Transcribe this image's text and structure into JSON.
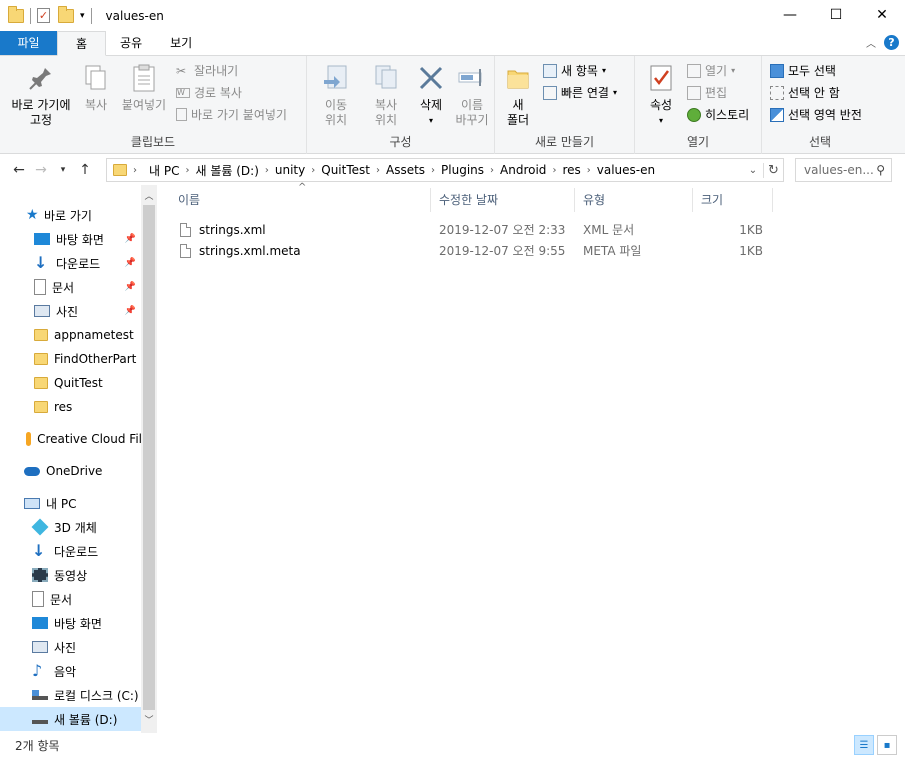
{
  "window": {
    "title": "values-en"
  },
  "ribbon_tabs": [
    {
      "label": "파일"
    },
    {
      "label": "홈"
    },
    {
      "label": "공유"
    },
    {
      "label": "보기"
    }
  ],
  "ribbon": {
    "clipboard": {
      "label": "클립보드",
      "pin": "바로 가기에\n고정",
      "copy": "복사",
      "paste": "붙여넣기",
      "cut": "잘라내기",
      "copy_path": "경로 복사",
      "paste_shortcut": "바로 가기 붙여넣기"
    },
    "organize": {
      "label": "구성",
      "move": "이동\n위치",
      "copyto": "복사\n위치",
      "delete": "삭제",
      "rename": "이름\n바꾸기"
    },
    "new": {
      "label": "새로 만들기",
      "new_folder": "새\n폴더",
      "new_item": "새 항목",
      "easy_access": "빠른 연결"
    },
    "open": {
      "label": "열기",
      "properties": "속성",
      "open": "열기",
      "edit": "편집",
      "history": "히스토리"
    },
    "select": {
      "label": "선택",
      "select_all": "모두 선택",
      "select_none": "선택 안 함",
      "invert": "선택 영역 반전"
    }
  },
  "address": {
    "crumbs": [
      "내 PC",
      "새 볼륨 (D:)",
      "unity",
      "QuitTest",
      "Assets",
      "Plugins",
      "Android",
      "res",
      "values-en"
    ],
    "search_placeholder": "values-en..."
  },
  "nav": [
    {
      "label": "바로 가기",
      "icon": "star-icon",
      "indent": 0,
      "pinned": false
    },
    {
      "label": "바탕 화면",
      "icon": "desktop-icon",
      "indent": 1,
      "pinned": true
    },
    {
      "label": "다운로드",
      "icon": "download-icon",
      "indent": 1,
      "pinned": true
    },
    {
      "label": "문서",
      "icon": "document-icon",
      "indent": 1,
      "pinned": true
    },
    {
      "label": "사진",
      "icon": "pictures-icon",
      "indent": 1,
      "pinned": true
    },
    {
      "label": "appnametest",
      "icon": "folder-icon",
      "indent": 1,
      "pinned": false
    },
    {
      "label": "FindOtherPart",
      "icon": "folder-icon",
      "indent": 1,
      "pinned": false
    },
    {
      "label": "QuitTest",
      "icon": "folder-icon",
      "indent": 1,
      "pinned": false
    },
    {
      "label": "res",
      "icon": "folder-icon",
      "indent": 1,
      "pinned": false
    },
    {
      "label": "Creative Cloud Fil",
      "icon": "creative-cloud-icon",
      "indent": 0,
      "pinned": false
    },
    {
      "label": "OneDrive",
      "icon": "onedrive-icon",
      "indent": 0,
      "pinned": false
    },
    {
      "label": "내 PC",
      "icon": "pc-icon",
      "indent": 0,
      "pinned": false
    },
    {
      "label": "3D 개체",
      "icon": "3d-objects-icon",
      "indent": 1,
      "pinned": false
    },
    {
      "label": "다운로드",
      "icon": "download-icon",
      "indent": 1,
      "pinned": false
    },
    {
      "label": "동영상",
      "icon": "video-icon",
      "indent": 1,
      "pinned": false
    },
    {
      "label": "문서",
      "icon": "document-icon",
      "indent": 1,
      "pinned": false
    },
    {
      "label": "바탕 화면",
      "icon": "desktop-icon",
      "indent": 1,
      "pinned": false
    },
    {
      "label": "사진",
      "icon": "pictures-icon",
      "indent": 1,
      "pinned": false
    },
    {
      "label": "음악",
      "icon": "music-icon",
      "indent": 1,
      "pinned": false
    },
    {
      "label": "로컬 디스크 (C:)",
      "icon": "drive-icon",
      "indent": 1,
      "pinned": false
    },
    {
      "label": "새 볼륨 (D:)",
      "icon": "drive-icon",
      "indent": 1,
      "pinned": false,
      "selected": true
    }
  ],
  "columns": {
    "name": "이름",
    "modified": "수정한 날짜",
    "type": "유형",
    "size": "크기"
  },
  "files": [
    {
      "name": "strings.xml",
      "modified": "2019-12-07 오전 2:33",
      "type": "XML 문서",
      "size": "1KB"
    },
    {
      "name": "strings.xml.meta",
      "modified": "2019-12-07 오전 9:55",
      "type": "META 파일",
      "size": "1KB"
    }
  ],
  "status": {
    "item_count": "2개 항목"
  },
  "colors": {
    "accent": "#1979ca",
    "selection": "#cce8ff"
  }
}
